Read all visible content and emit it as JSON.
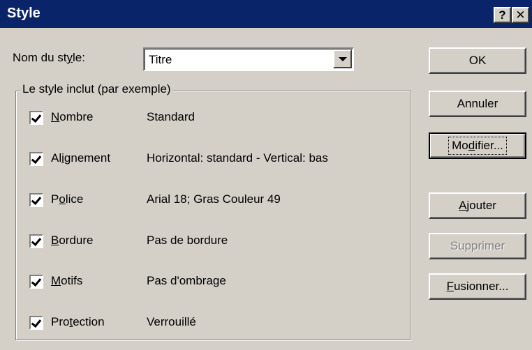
{
  "window": {
    "title": "Style",
    "help_glyph": "?",
    "close_glyph": "✕"
  },
  "style_name": {
    "label_pre": "Nom du st",
    "label_accel": "y",
    "label_post": "le:",
    "value": "Titre"
  },
  "group": {
    "legend": "Le style inclut (par exemple)",
    "items": [
      {
        "checked": true,
        "label_pre": "",
        "accel": "N",
        "label_post": "ombre",
        "value": "Standard"
      },
      {
        "checked": true,
        "label_pre": "Al",
        "accel": "i",
        "label_post": "gnement",
        "value": "Horizontal: standard - Vertical: bas"
      },
      {
        "checked": true,
        "label_pre": "P",
        "accel": "o",
        "label_post": "lice",
        "value": "Arial 18; Gras Couleur 49"
      },
      {
        "checked": true,
        "label_pre": "",
        "accel": "B",
        "label_post": "ordure",
        "value": "Pas de bordure"
      },
      {
        "checked": true,
        "label_pre": "",
        "accel": "M",
        "label_post": "otifs",
        "value": "Pas d'ombrage"
      },
      {
        "checked": true,
        "label_pre": "Pro",
        "accel": "t",
        "label_post": "ection",
        "value": "Verrouillé"
      }
    ]
  },
  "buttons": {
    "ok": "OK",
    "cancel": "Annuler",
    "modify_pre": "Mo",
    "modify_accel": "d",
    "modify_post": "ifier...",
    "add_pre": "",
    "add_accel": "A",
    "add_post": "jouter",
    "delete": "Supprimer",
    "merge_pre": "",
    "merge_accel": "F",
    "merge_post": "usionner..."
  },
  "colors": {
    "titlebar": "#0a246a",
    "face": "#d4d0c8",
    "disabled_text": "#808080"
  }
}
